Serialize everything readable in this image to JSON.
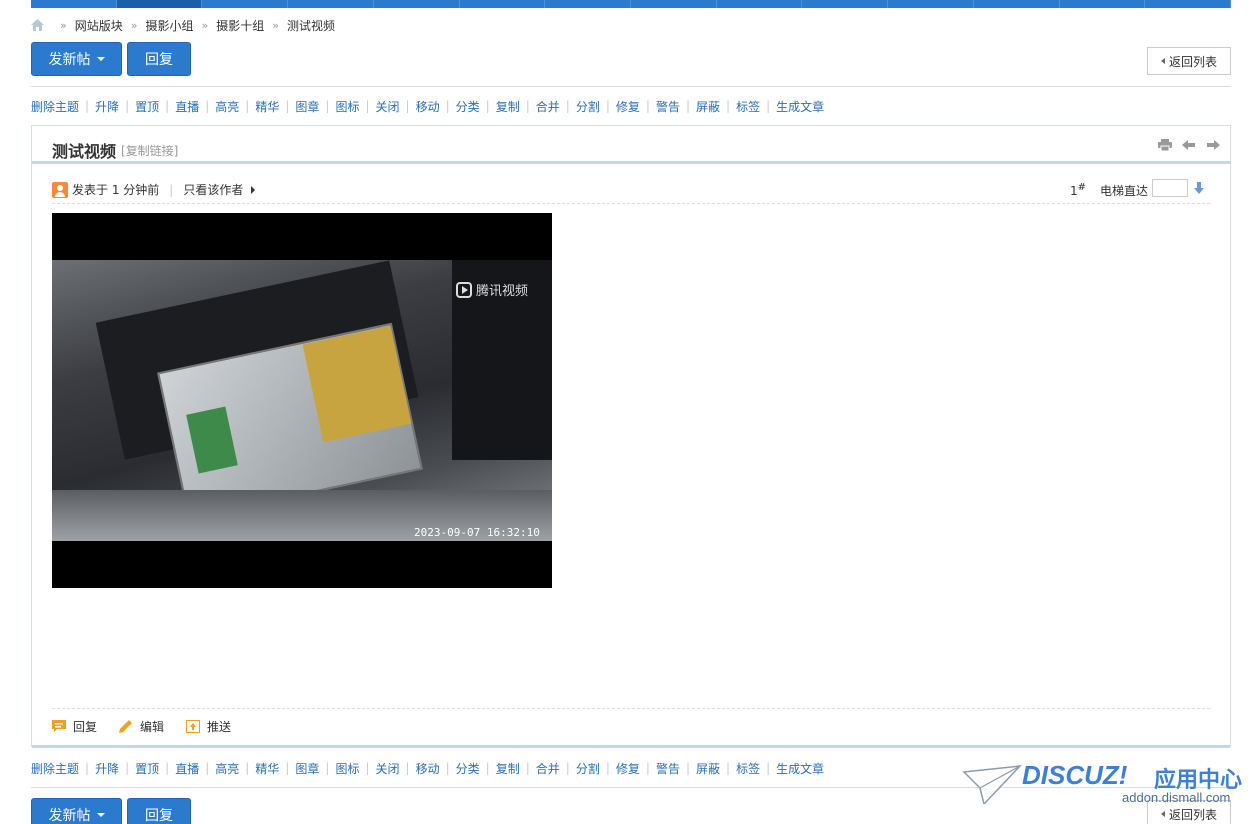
{
  "breadcrumb": {
    "items": [
      "网站版块",
      "摄影小组",
      "摄影十组",
      "测试视频"
    ],
    "separator": "»"
  },
  "toolbar": {
    "new_post_label": "发新帖",
    "reply_label": "回复",
    "back_label": "返回列表"
  },
  "mod_actions": [
    "删除主题",
    "升降",
    "置顶",
    "直播",
    "高亮",
    "精华",
    "图章",
    "图标",
    "关闭",
    "移动",
    "分类",
    "复制",
    "合并",
    "分割",
    "修复",
    "警告",
    "屏蔽",
    "标签",
    "生成文章"
  ],
  "thread": {
    "title": "测试视频",
    "copy_link": "[复制链接]"
  },
  "post": {
    "posted_label": "发表于 1 分钟前",
    "only_author_label": "只看该作者",
    "floor_number": "1",
    "floor_sup": "#",
    "elevator_label": "电梯直达",
    "elevator_value": ""
  },
  "video": {
    "watermark": "腾讯视频",
    "timestamp": "2023-09-07 16:32:10"
  },
  "post_actions": {
    "reply": "回复",
    "edit": "编辑",
    "push": "推送"
  },
  "branding": {
    "logo_text": "DISCUZ!",
    "logo_cn": "应用中心",
    "logo_url": "addon.dismall.com"
  },
  "colors": {
    "primary": "#2b7acd",
    "link": "#2b6fb6",
    "accent_orange": "#f48a3c"
  }
}
